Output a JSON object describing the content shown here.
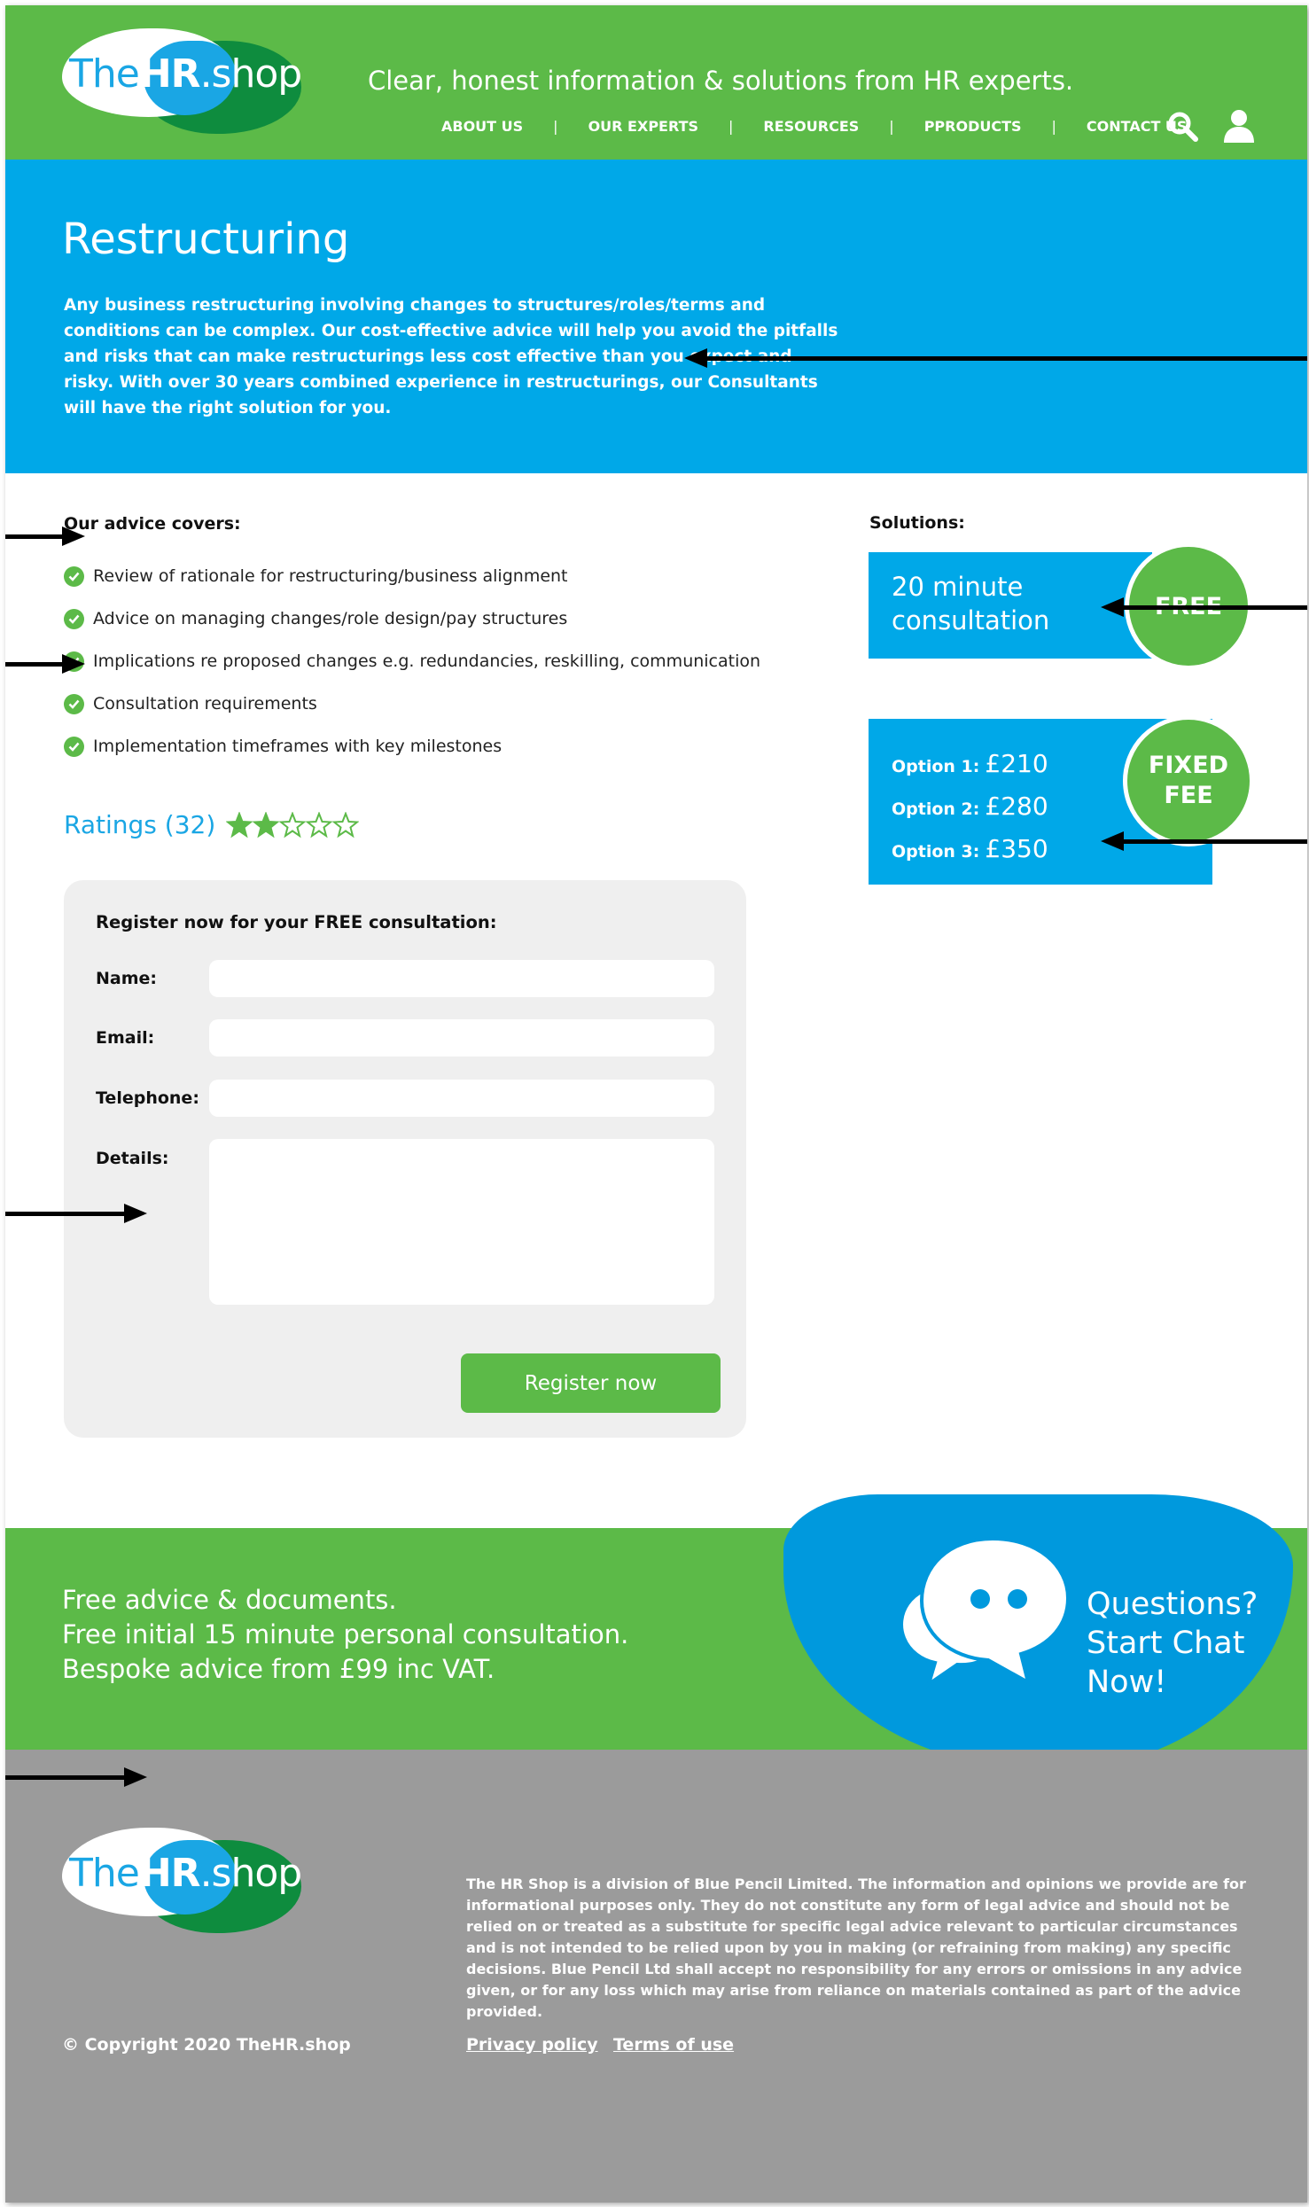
{
  "colors": {
    "header_green": "#5cba48",
    "hero_blue": "#00a8e8",
    "logo_blue": "#1aa6e4",
    "logo_dark_green": "#0e8c3e",
    "footer_grey": "#9b9b9b",
    "form_bg": "#efefef"
  },
  "header": {
    "logo": {
      "the": "The",
      "hr": "HR",
      "shop": ".shop"
    },
    "tagline": "Clear, honest information & solutions from HR experts.",
    "nav": [
      "ABOUT US",
      "OUR EXPERTS",
      "RESOURCES",
      "PPRODUCTS",
      "CONTACT US"
    ],
    "nav_separator": "|",
    "icons": [
      "search-icon",
      "user-icon"
    ]
  },
  "hero": {
    "title": "Restructuring",
    "text": "Any business restructuring involving changes to structures/roles/terms and conditions can be complex. Our cost-effective advice will help you avoid the pitfalls and risks that can make restructurings less cost effective than you expect and risky. With over 30 years combined experience in restructurings, our Consultants will have the right solution for you."
  },
  "advice": {
    "heading": "Our advice covers:",
    "items": [
      "Review of rationale for restructuring/business alignment",
      "Advice on managing changes/role design/pay structures",
      "Implications re proposed changes e.g. redundancies, reskilling, communication",
      "Consultation requirements",
      "Implementation timeframes with key milestones"
    ]
  },
  "ratings": {
    "label": "Ratings (32)",
    "stars_filled": 2,
    "stars_total": 5
  },
  "form": {
    "heading": "Register now for your FREE consultation:",
    "name_label": "Name:",
    "email_label": "Email:",
    "telephone_label": "Telephone:",
    "details_label": "Details:",
    "name_value": "",
    "email_value": "",
    "telephone_value": "",
    "details_value": "",
    "submit_label": "Register now"
  },
  "solutions": {
    "heading": "Solutions:",
    "consultation_title": "20 minute consultation",
    "free_badge": "FREE",
    "fixed_badge_line1": "FIXED",
    "fixed_badge_line2": "FEE",
    "options": [
      {
        "label": "Option 1:",
        "price": "£210"
      },
      {
        "label": "Option 2:",
        "price": "£280"
      },
      {
        "label": "Option 3:",
        "price": "£350"
      }
    ]
  },
  "band": {
    "lines": [
      "Free advice & documents.",
      "Free initial 15 minute personal consultation.",
      "Bespoke advice from £99 inc VAT."
    ],
    "chat_line1": "Questions?",
    "chat_line2": "Start Chat",
    "chat_line3": "Now!"
  },
  "footer": {
    "disclaimer": "The HR Shop is a division of Blue Pencil Limited. The information and opinions we provide are for informational purposes only. They do not constitute any form of legal advice and should not be relied on or treated as a substitute for specific legal advice relevant to particular circumstances and is not intended to be relied upon by you in making (or refraining from making) any specific decisions. Blue Pencil Ltd shall accept no responsibility for any errors or omissions in any advice given, or for any loss which may arise from reliance on materials contained as part of the advice provided.",
    "copyright": "© Copyright 2020 TheHR.shop",
    "privacy_label": "Privacy policy",
    "terms_label": "Terms of use"
  }
}
